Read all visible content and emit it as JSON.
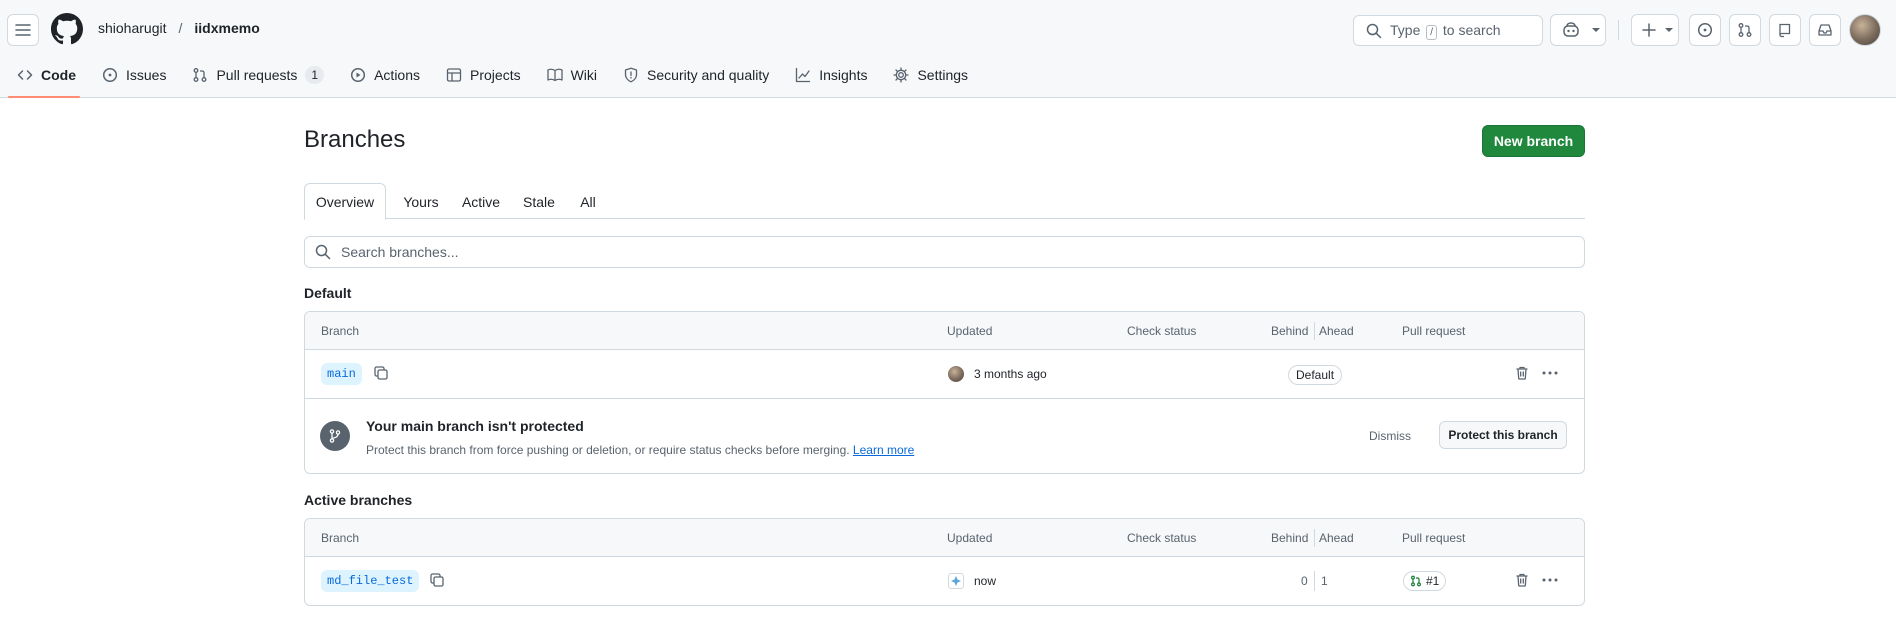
{
  "header": {
    "owner": "shioharugit",
    "separator": "/",
    "repo": "iidxmemo",
    "search_prefix": "Type",
    "search_key": "/",
    "search_suffix": "to search"
  },
  "nav": {
    "items": [
      {
        "label": "Code",
        "icon": "code-icon"
      },
      {
        "label": "Issues",
        "icon": "issue-icon"
      },
      {
        "label": "Pull requests",
        "icon": "pull-request-icon",
        "count": "1"
      },
      {
        "label": "Actions",
        "icon": "play-icon"
      },
      {
        "label": "Projects",
        "icon": "table-icon"
      },
      {
        "label": "Wiki",
        "icon": "book-icon"
      },
      {
        "label": "Security and quality",
        "icon": "shield-icon"
      },
      {
        "label": "Insights",
        "icon": "graph-icon"
      },
      {
        "label": "Settings",
        "icon": "gear-icon"
      }
    ]
  },
  "page": {
    "title": "Branches",
    "new_branch": "New branch"
  },
  "tabs": [
    "Overview",
    "Yours",
    "Active",
    "Stale",
    "All"
  ],
  "search": {
    "placeholder": "Search branches..."
  },
  "columns": {
    "branch": "Branch",
    "updated": "Updated",
    "check_status": "Check status",
    "behind": "Behind",
    "ahead": "Ahead",
    "pull_request": "Pull request"
  },
  "default_section": {
    "title": "Default",
    "branch": "main",
    "updated": "3 months ago",
    "label": "Default",
    "banner": {
      "title": "Your main branch isn't protected",
      "description": "Protect this branch from force pushing or deletion, or require status checks before merging.",
      "link": "Learn more",
      "dismiss": "Dismiss",
      "protect": "Protect this branch"
    }
  },
  "active_section": {
    "title": "Active branches",
    "branch": "md_file_test",
    "updated": "now",
    "behind": "0",
    "ahead": "1",
    "pr": "#1"
  },
  "colors": {
    "primary_button": "#1f883d",
    "link": "#0969da",
    "underline": "#fd8c73"
  }
}
